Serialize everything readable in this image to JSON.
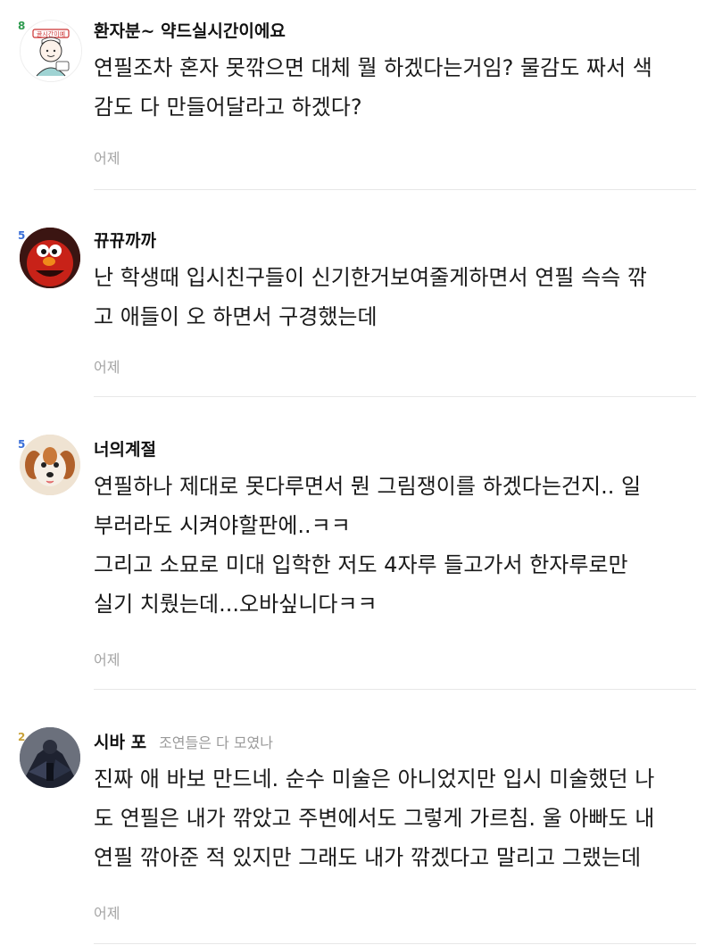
{
  "comments": [
    {
      "level": "8",
      "avatar_badge": "골시간이예",
      "nickname": "환자분~ 약드실시간이에요",
      "nickname_sub": "",
      "lines": [
        "연필조차 혼자 못깎으면 대체 뭘 하겠다는거임? 물감도 짜서 색",
        "감도 다 만들어달라고 하겠다?"
      ],
      "date": "어제"
    },
    {
      "level": "5",
      "nickname": "뀨뀨까까",
      "nickname_sub": "",
      "lines": [
        "난 학생때 입시친구들이 신기한거보여줄게하면서 연필 슥슥 깎",
        "고 애들이 오 하면서 구경했는데"
      ],
      "date": "어제"
    },
    {
      "level": "5",
      "nickname": "너의계절",
      "nickname_sub": "",
      "lines": [
        "연필하나 제대로 못다루면서 뭔 그림쟁이를 하겠다는건지.. 일",
        "부러라도 시켜야할판에..ㅋㅋ",
        "그리고 소묘로 미대 입학한 저도 4자루 들고가서 한자루로만",
        "실기 치뤘는데...오바싶니다ㅋㅋ"
      ],
      "date": "어제"
    },
    {
      "level": "2",
      "nickname": "시바 포",
      "nickname_sub": "조연들은 다 모였나",
      "lines": [
        "진짜 애 바보 만드네. 순수 미술은 아니었지만 입시 미술했던 나",
        "도 연필은 내가 깎았고 주변에서도 그렇게 가르침. 울 아빠도 내",
        "연필 깎아준 적 있지만 그래도 내가 깎겠다고 말리고 그랬는데"
      ],
      "date": "어제"
    }
  ],
  "colors": {
    "level_8": "#2e9b4f",
    "level_5": "#3a6fd8",
    "level_2": "#c9a23a"
  }
}
